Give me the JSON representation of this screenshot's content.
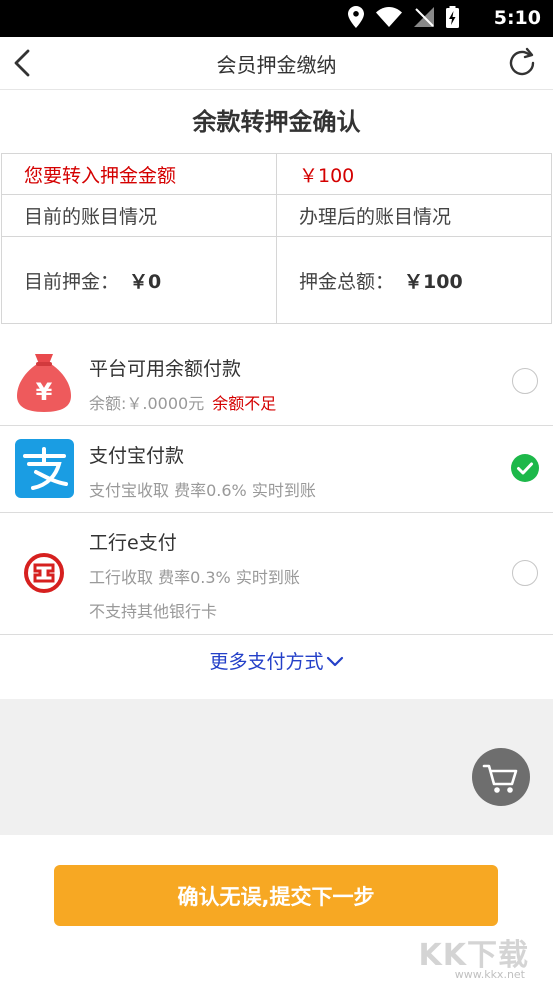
{
  "status_bar": {
    "time": "5:10"
  },
  "nav": {
    "title": "会员押金缴纳"
  },
  "confirm_title": "余款转押金确认",
  "table": {
    "transfer_label": "您要转入押金金额",
    "transfer_value": "￥100",
    "current_header": "目前的账目情况",
    "after_header": "办理后的账目情况",
    "current_deposit_label": "目前押金：",
    "current_deposit_value": "￥0",
    "total_deposit_label": "押金总额：",
    "total_deposit_value": "￥100"
  },
  "payment_methods": [
    {
      "name": "平台可用余额付款",
      "desc": "余额:￥.0000元",
      "warning": "余额不足",
      "selected": false
    },
    {
      "name": "支付宝付款",
      "desc": "支付宝收取 费率0.6% 实时到账",
      "selected": true
    },
    {
      "name": "工行e支付",
      "desc": "工行收取 费率0.3% 实时到账",
      "note": "不支持其他银行卡",
      "selected": false
    }
  ],
  "more_label": "更多支付方式",
  "submit_label": "确认无误,提交下一步",
  "watermark": {
    "text": "KK下载",
    "url": "www.kkx.net"
  },
  "colors": {
    "accent_orange": "#f7a823",
    "warning_red": "#d40000",
    "link_blue": "#2440c8",
    "alipay_blue": "#1a9de3",
    "check_green": "#1db84a"
  },
  "icons": [
    "back-arrow-icon",
    "refresh-icon",
    "money-bag-icon",
    "alipay-icon",
    "icbc-icon",
    "chevron-down-icon",
    "cart-icon"
  ]
}
